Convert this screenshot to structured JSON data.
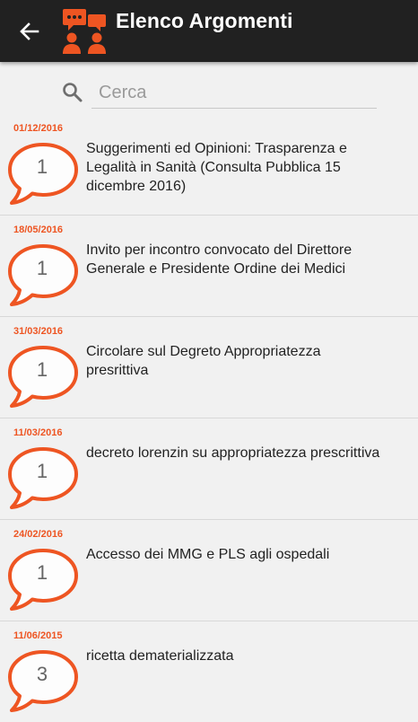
{
  "app": {
    "title": "Elenco Argomenti",
    "accent_color": "#ee5522",
    "bar_color": "#212121",
    "back_icon": "arrow-left-icon",
    "logo_icon": "discussion-people-icon"
  },
  "search": {
    "placeholder": "Cerca",
    "value": "",
    "icon": "search-icon"
  },
  "topics": [
    {
      "date": "01/12/2016",
      "count": "1",
      "title": "Suggerimenti ed Opinioni: Trasparenza e Legalità in Sanità (Consulta Pubblica 15 dicembre 2016)"
    },
    {
      "date": "18/05/2016",
      "count": "1",
      "title": "Invito per incontro convocato del Direttore Generale e Presidente Ordine dei Medici"
    },
    {
      "date": "31/03/2016",
      "count": "1",
      "title": "Circolare sul Degreto Appropriatezza presrittiva"
    },
    {
      "date": "11/03/2016",
      "count": "1",
      "title": "decreto lorenzin su appropriatezza prescrittiva"
    },
    {
      "date": "24/02/2016",
      "count": "1",
      "title": "Accesso dei MMG e PLS agli ospedali"
    },
    {
      "date": "11/06/2015",
      "count": "3",
      "title": "ricetta dematerializzata"
    }
  ]
}
